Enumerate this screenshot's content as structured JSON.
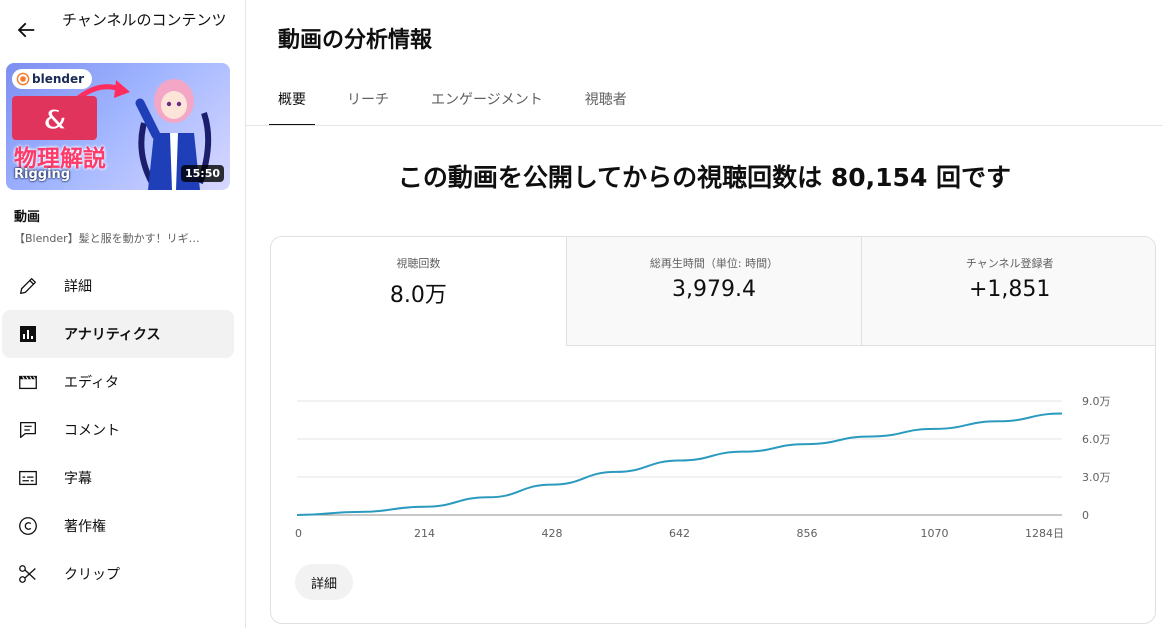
{
  "sidebar": {
    "channel_title": "チャンネルのコンテンツ",
    "thumbnail": {
      "logo_text": "blender",
      "title_big": "髪&服",
      "title_sub": "物理解説",
      "title_rigging": "Rigging",
      "duration": "15:50"
    },
    "video_label": "動画",
    "video_title": "【Blender】髪と服を動かす！リギ…",
    "items": [
      {
        "label": "詳細",
        "icon": "pencil-icon"
      },
      {
        "label": "アナリティクス",
        "icon": "analytics-icon"
      },
      {
        "label": "エディタ",
        "icon": "editor-icon"
      },
      {
        "label": "コメント",
        "icon": "comment-icon"
      },
      {
        "label": "字幕",
        "icon": "subtitles-icon"
      },
      {
        "label": "著作権",
        "icon": "copyright-icon"
      },
      {
        "label": "クリップ",
        "icon": "scissors-icon"
      }
    ]
  },
  "main": {
    "page_title": "動画の分析情報",
    "tabs": [
      {
        "label": "概要"
      },
      {
        "label": "リーチ"
      },
      {
        "label": "エンゲージメント"
      },
      {
        "label": "視聴者"
      }
    ],
    "headline": "この動画を公開してからの視聴回数は 80,154 回です",
    "metrics": [
      {
        "label": "視聴回数",
        "value": "8.0万"
      },
      {
        "label": "総再生時間（単位: 時間）",
        "value": "3,979.4"
      },
      {
        "label": "チャンネル登録者",
        "value": "+1,851"
      }
    ],
    "details_button": "詳細"
  },
  "chart_data": {
    "type": "line",
    "x_tick_labels": [
      "0",
      "214",
      "428",
      "642",
      "856",
      "1070",
      "1284日"
    ],
    "y_tick_labels": [
      "0",
      "3.0万",
      "6.0万",
      "9.0万"
    ],
    "ylim": [
      0,
      90000
    ],
    "xlim": [
      0,
      1284
    ],
    "line_color": "#2b9abf",
    "series": [
      {
        "x": [
          0,
          107,
          214,
          321,
          428,
          535,
          642,
          749,
          856,
          963,
          1070,
          1177,
          1284
        ],
        "values": [
          0,
          2500,
          6500,
          14000,
          24000,
          34000,
          43000,
          50000,
          56000,
          62000,
          68000,
          74000,
          80154
        ]
      }
    ]
  }
}
